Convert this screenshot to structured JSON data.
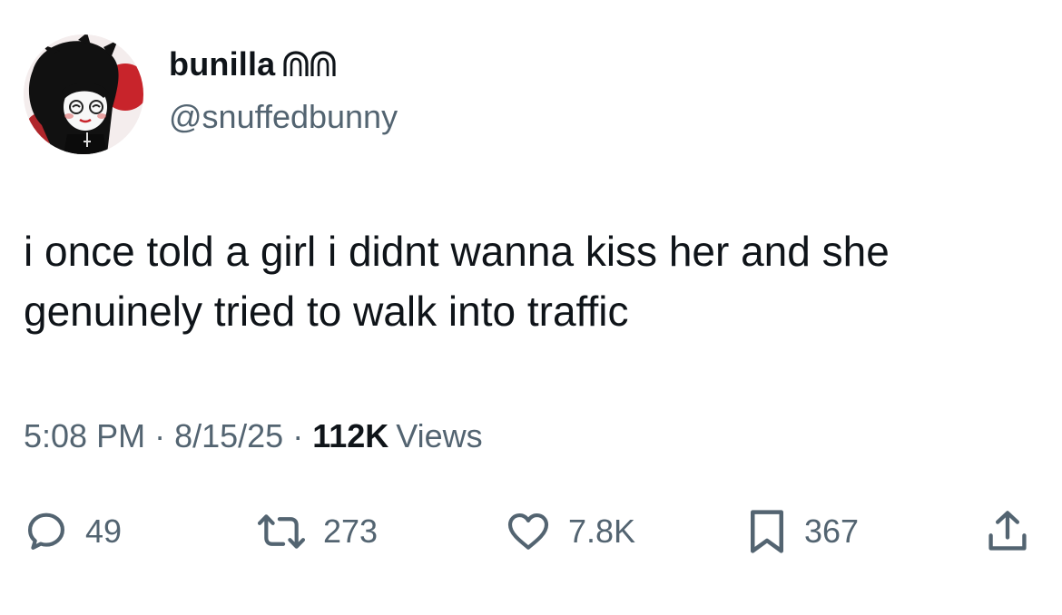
{
  "author": {
    "display_name": "bunilla",
    "name_emoji": "bunny-ears-emoji",
    "handle": "@snuffedbunny",
    "avatar": "avatar-image"
  },
  "tweet": {
    "text_line1": "i once told a girl i didnt wanna kiss her and she",
    "text_line2": "genuinely tried to walk into traffic"
  },
  "meta": {
    "time": "5:08 PM",
    "date": "8/15/25",
    "separator": "·",
    "views_count": "112K",
    "views_label": "Views"
  },
  "actions": {
    "replies": {
      "icon": "reply-icon",
      "count": "49"
    },
    "reposts": {
      "icon": "repost-icon",
      "count": "273"
    },
    "likes": {
      "icon": "heart-icon",
      "count": "7.8K"
    },
    "bookmarks": {
      "icon": "bookmark-icon",
      "count": "367"
    },
    "share": {
      "icon": "share-icon"
    }
  },
  "colors": {
    "text": "#0f1419",
    "secondary": "#536471",
    "background": "#ffffff"
  }
}
